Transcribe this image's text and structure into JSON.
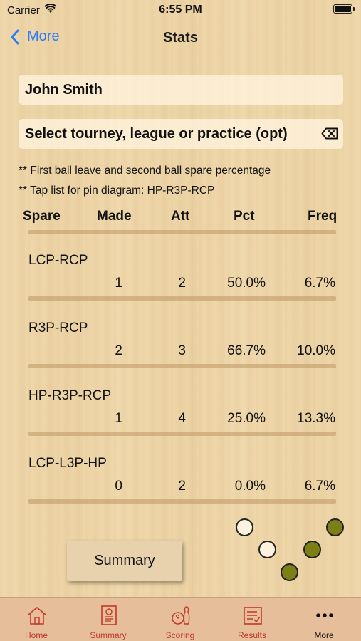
{
  "status_bar": {
    "carrier": "Carrier",
    "time": "6:55 PM"
  },
  "nav": {
    "back_label": "More",
    "title": "Stats"
  },
  "filters": {
    "bowler_name": "John Smith",
    "event_placeholder": "Select tourney, league or practice (opt)"
  },
  "notes": {
    "line1": "** First ball leave and second ball spare percentage",
    "line2": "** Tap list for pin diagram:      HP-R3P-RCP"
  },
  "table": {
    "headers": {
      "spare": "Spare",
      "made": "Made",
      "att": "Att",
      "pct": "Pct",
      "freq": "Freq"
    },
    "rows": [
      {
        "spare": "LCP-RCP",
        "made": "1",
        "att": "2",
        "pct": "50.0%",
        "freq": "6.7%"
      },
      {
        "spare": "R3P-RCP",
        "made": "2",
        "att": "3",
        "pct": "66.7%",
        "freq": "10.0%"
      },
      {
        "spare": "HP-R3P-RCP",
        "made": "1",
        "att": "4",
        "pct": "25.0%",
        "freq": "13.3%"
      },
      {
        "spare": "LCP-L3P-HP",
        "made": "0",
        "att": "2",
        "pct": "0.0%",
        "freq": "6.7%"
      }
    ]
  },
  "pin_diagram": {
    "pins": [
      {
        "name": "lcp",
        "state": "down"
      },
      {
        "name": "rcp",
        "state": "standing"
      },
      {
        "name": "l3p",
        "state": "down"
      },
      {
        "name": "r3p",
        "state": "standing"
      },
      {
        "name": "hp",
        "state": "standing"
      }
    ],
    "standing_color": "#7c7e16"
  },
  "summary_button": {
    "label": "Summary"
  },
  "tabbar": {
    "tabs": [
      {
        "label": "Home",
        "icon": "home-icon"
      },
      {
        "label": "Summary",
        "icon": "summary-report-icon"
      },
      {
        "label": "Scoring",
        "icon": "bowling-icon"
      },
      {
        "label": "Results",
        "icon": "results-list-icon"
      },
      {
        "label": "More",
        "icon": "more-dots-icon",
        "active": true
      }
    ],
    "accent_color": "#c0392b"
  }
}
